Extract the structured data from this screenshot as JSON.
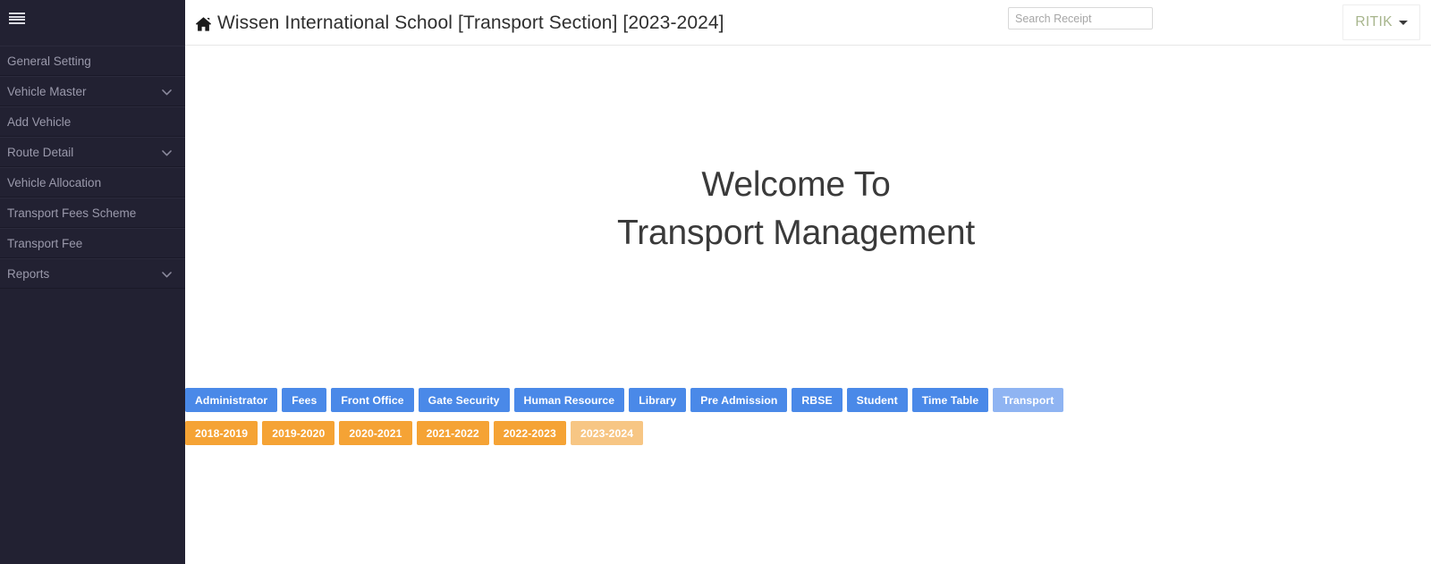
{
  "sidebar": {
    "menu_icon": "hamburger-icon",
    "items": [
      {
        "label": "General Setting",
        "has_chevron": false
      },
      {
        "label": "Vehicle Master",
        "has_chevron": true
      },
      {
        "label": "Add Vehicle",
        "has_chevron": false
      },
      {
        "label": "Route Detail",
        "has_chevron": true
      },
      {
        "label": "Vehicle Allocation",
        "has_chevron": false
      },
      {
        "label": "Transport Fees Scheme",
        "has_chevron": false
      },
      {
        "label": "Transport Fee",
        "has_chevron": false
      },
      {
        "label": "Reports",
        "has_chevron": true
      }
    ]
  },
  "header": {
    "home_icon": "home-icon",
    "title": "Wissen International School [Transport Section] [2023-2024]",
    "search": {
      "placeholder": "Search Receipt",
      "value": ""
    },
    "user": {
      "name": "RITIK",
      "caret_icon": "caret-down-icon"
    }
  },
  "main": {
    "welcome_line1": "Welcome To",
    "welcome_line2": "Transport Management",
    "modules": [
      {
        "label": "Administrator",
        "active": false
      },
      {
        "label": "Fees",
        "active": false
      },
      {
        "label": "Front Office",
        "active": false
      },
      {
        "label": "Gate Security",
        "active": false
      },
      {
        "label": "Human Resource",
        "active": false
      },
      {
        "label": "Library",
        "active": false
      },
      {
        "label": "Pre Admission",
        "active": false
      },
      {
        "label": "RBSE",
        "active": false
      },
      {
        "label": "Student",
        "active": false
      },
      {
        "label": "Time Table",
        "active": false
      },
      {
        "label": "Transport",
        "active": true
      }
    ],
    "sessions": [
      {
        "label": "2018-2019",
        "active": false
      },
      {
        "label": "2019-2020",
        "active": false
      },
      {
        "label": "2020-2021",
        "active": false
      },
      {
        "label": "2021-2022",
        "active": false
      },
      {
        "label": "2022-2023",
        "active": false
      },
      {
        "label": "2023-2024",
        "active": true
      }
    ]
  },
  "colors": {
    "sidebar_bg": "#222132",
    "module_blue": "#4a89e8",
    "module_blue_active": "#8fb4f2",
    "session_orange": "#f5a335",
    "session_orange_active": "#f7c684",
    "user_name": "#a7b58c"
  }
}
